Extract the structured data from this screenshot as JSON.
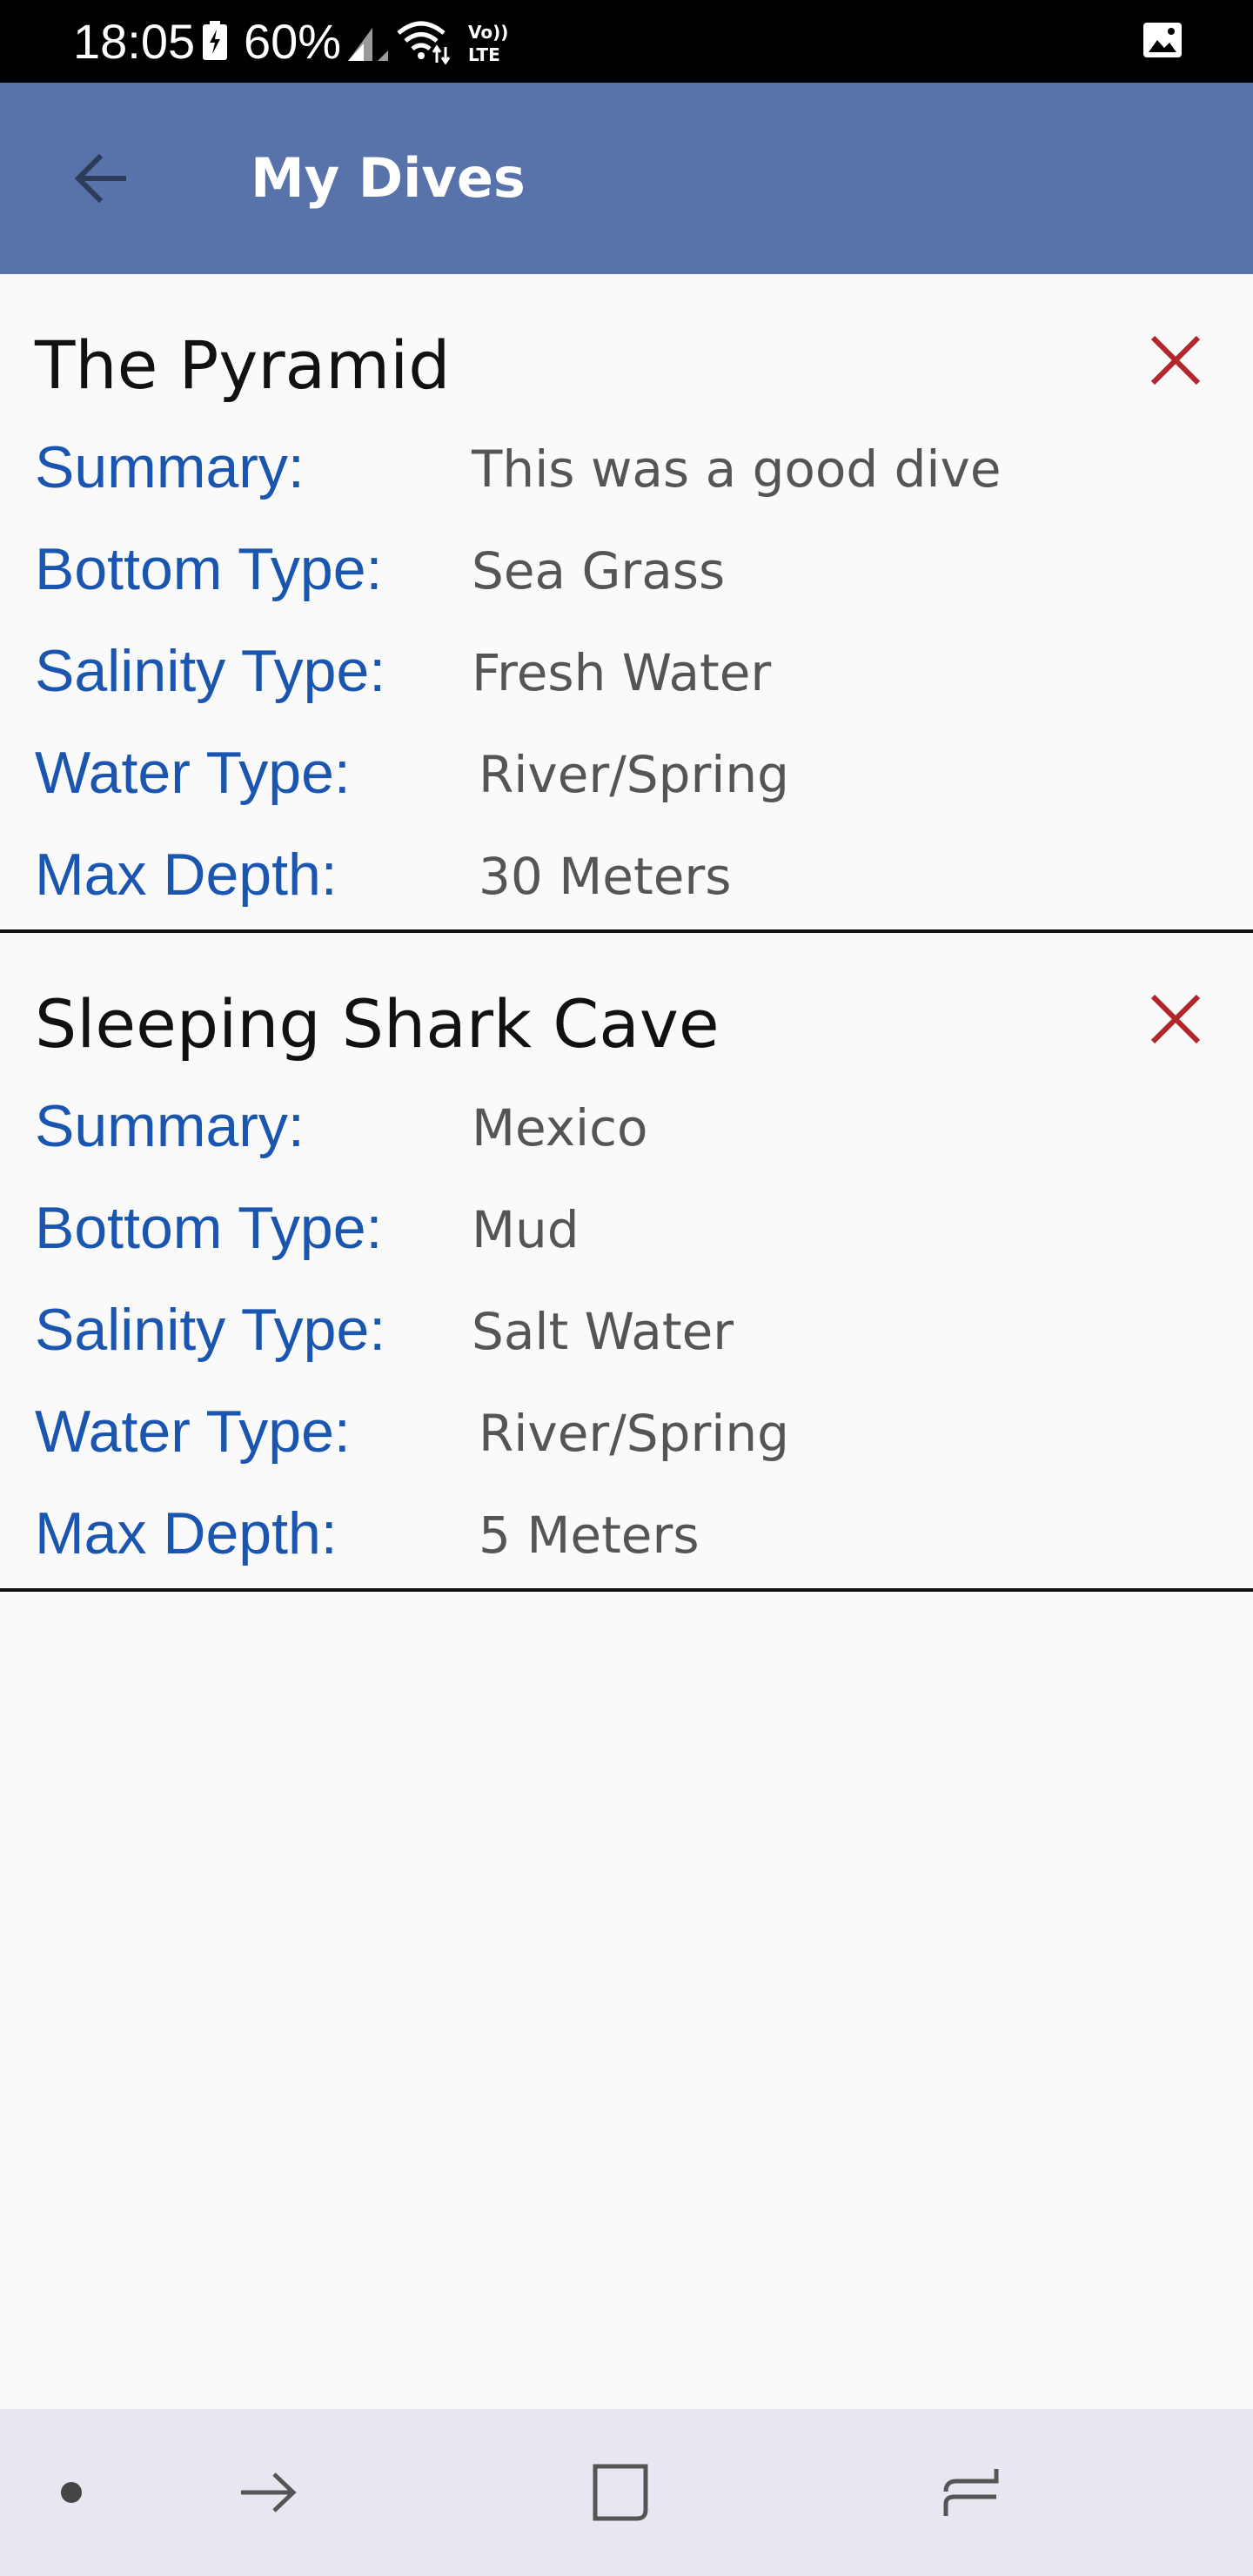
{
  "status_bar": {
    "time": "18:05",
    "battery": "60%",
    "icons": [
      "battery-charging-icon",
      "signal-icon",
      "wifi-icon",
      "volte-icon",
      "gallery-notification-icon"
    ]
  },
  "app_bar": {
    "title": "My Dives",
    "back_icon": "arrow-left-icon",
    "color": "#5872aa"
  },
  "labels": {
    "summary": "Summary:",
    "bottom_type": "Bottom Type:",
    "salinity_type": "Salinity Type:",
    "water_type": "Water Type:",
    "max_depth": "Max Depth:"
  },
  "dives": [
    {
      "name": "The Pyramid",
      "summary": "This was a good dive",
      "bottom_type": "Sea Grass",
      "salinity_type": "Fresh Water",
      "water_type": "River/Spring",
      "max_depth": "30 Meters"
    },
    {
      "name": "Sleeping Shark Cave",
      "summary": "Mexico",
      "bottom_type": "Mud",
      "salinity_type": "Salt Water",
      "water_type": "River/Spring",
      "max_depth": "5 Meters"
    }
  ],
  "colors": {
    "label": "#1a55b0",
    "value": "#555555",
    "delete": "#b3262a",
    "divider": "#111111"
  },
  "nav_bar": {
    "icons": [
      "dot-icon",
      "back-gesture-icon",
      "home-icon",
      "recents-icon"
    ]
  }
}
